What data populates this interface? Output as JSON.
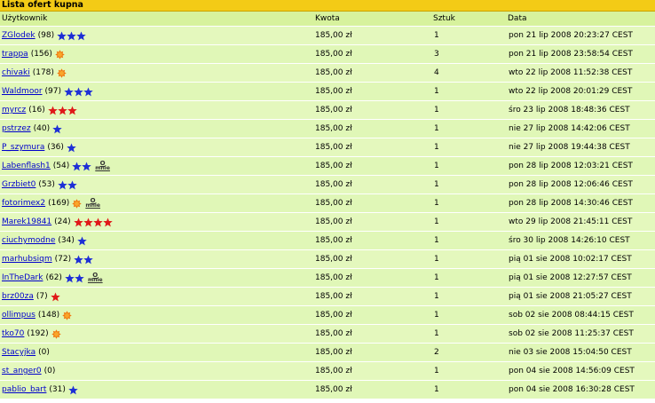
{
  "title": "Lista ofert kupna",
  "columns": {
    "user": "Użytkownik",
    "price": "Kwota",
    "qty": "Sztuk",
    "date": "Data"
  },
  "colors": {
    "header": "#f3cb16",
    "row": "#e4f8bd",
    "link": "#0000cc",
    "blue_star": "#1e2fd6",
    "red_star": "#e01818",
    "sun": "#f07a10"
  },
  "omnie": {
    "top": "O",
    "bottom": "mnie"
  },
  "rows": [
    {
      "user": "ZGlodek",
      "score": "(98)",
      "badge": "blue-star",
      "badge_count": 3,
      "omnie": false,
      "price": "185,00 zł",
      "qty": "1",
      "date": "pon 21 lip 2008 20:23:27 CEST"
    },
    {
      "user": "trappa",
      "score": "(156)",
      "badge": "sun",
      "badge_count": 1,
      "omnie": false,
      "price": "185,00 zł",
      "qty": "3",
      "date": "pon 21 lip 2008 23:58:54 CEST"
    },
    {
      "user": "chivaki",
      "score": "(178)",
      "badge": "sun",
      "badge_count": 1,
      "omnie": false,
      "price": "185,00 zł",
      "qty": "4",
      "date": "wto 22 lip 2008 11:52:38 CEST"
    },
    {
      "user": "Waldmoor",
      "score": "(97)",
      "badge": "blue-star",
      "badge_count": 3,
      "omnie": false,
      "price": "185,00 zł",
      "qty": "1",
      "date": "wto 22 lip 2008 20:01:29 CEST"
    },
    {
      "user": "myrcz",
      "score": "(16)",
      "badge": "red-star",
      "badge_count": 3,
      "omnie": false,
      "price": "185,00 zł",
      "qty": "1",
      "date": "śro 23 lip 2008 18:48:36 CEST"
    },
    {
      "user": "pstrzez",
      "score": "(40)",
      "badge": "blue-star",
      "badge_count": 1,
      "omnie": false,
      "price": "185,00 zł",
      "qty": "1",
      "date": "nie 27 lip 2008 14:42:06 CEST"
    },
    {
      "user": "P_szymura",
      "score": "(36)",
      "badge": "blue-star",
      "badge_count": 1,
      "omnie": false,
      "price": "185,00 zł",
      "qty": "1",
      "date": "nie 27 lip 2008 19:44:38 CEST"
    },
    {
      "user": "Labenflash1",
      "score": "(54)",
      "badge": "blue-star",
      "badge_count": 2,
      "omnie": true,
      "price": "185,00 zł",
      "qty": "1",
      "date": "pon 28 lip 2008 12:03:21 CEST"
    },
    {
      "user": "Grzbiet0",
      "score": "(53)",
      "badge": "blue-star",
      "badge_count": 2,
      "omnie": false,
      "price": "185,00 zł",
      "qty": "1",
      "date": "pon 28 lip 2008 12:06:46 CEST"
    },
    {
      "user": "fotorimex2",
      "score": "(169)",
      "badge": "sun",
      "badge_count": 1,
      "omnie": true,
      "price": "185,00 zł",
      "qty": "1",
      "date": "pon 28 lip 2008 14:30:46 CEST"
    },
    {
      "user": "Marek19841",
      "score": "(24)",
      "badge": "red-star",
      "badge_count": 4,
      "omnie": false,
      "price": "185,00 zł",
      "qty": "1",
      "date": "wto 29 lip 2008 21:45:11 CEST"
    },
    {
      "user": "ciuchymodne",
      "score": "(34)",
      "badge": "blue-star",
      "badge_count": 1,
      "omnie": false,
      "price": "185,00 zł",
      "qty": "1",
      "date": "śro 30 lip 2008 14:26:10 CEST"
    },
    {
      "user": "marhubsiqm",
      "score": "(72)",
      "badge": "blue-star",
      "badge_count": 2,
      "omnie": false,
      "price": "185,00 zł",
      "qty": "1",
      "date": "pią 01 sie 2008 10:02:17 CEST"
    },
    {
      "user": "InTheDark",
      "score": "(62)",
      "badge": "blue-star",
      "badge_count": 2,
      "omnie": true,
      "price": "185,00 zł",
      "qty": "1",
      "date": "pią 01 sie 2008 12:27:57 CEST"
    },
    {
      "user": "brz00za",
      "score": "(7)",
      "badge": "red-star",
      "badge_count": 1,
      "omnie": false,
      "price": "185,00 zł",
      "qty": "1",
      "date": "pią 01 sie 2008 21:05:27 CEST"
    },
    {
      "user": "ollimpus",
      "score": "(148)",
      "badge": "sun",
      "badge_count": 1,
      "omnie": false,
      "price": "185,00 zł",
      "qty": "1",
      "date": "sob 02 sie 2008 08:44:15 CEST"
    },
    {
      "user": "tko70",
      "score": "(192)",
      "badge": "sun",
      "badge_count": 1,
      "omnie": false,
      "price": "185,00 zł",
      "qty": "1",
      "date": "sob 02 sie 2008 11:25:37 CEST"
    },
    {
      "user": "Stacyjka",
      "score": "(0)",
      "badge": "none",
      "badge_count": 0,
      "omnie": false,
      "price": "185,00 zł",
      "qty": "2",
      "date": "nie 03 sie 2008 15:04:50 CEST"
    },
    {
      "user": "st_anger0",
      "score": "(0)",
      "badge": "none",
      "badge_count": 0,
      "omnie": false,
      "price": "185,00 zł",
      "qty": "1",
      "date": "pon 04 sie 2008 14:56:09 CEST"
    },
    {
      "user": "pablio_bart",
      "score": "(31)",
      "badge": "blue-star",
      "badge_count": 1,
      "omnie": false,
      "price": "185,00 zł",
      "qty": "1",
      "date": "pon 04 sie 2008 16:30:28 CEST"
    }
  ]
}
